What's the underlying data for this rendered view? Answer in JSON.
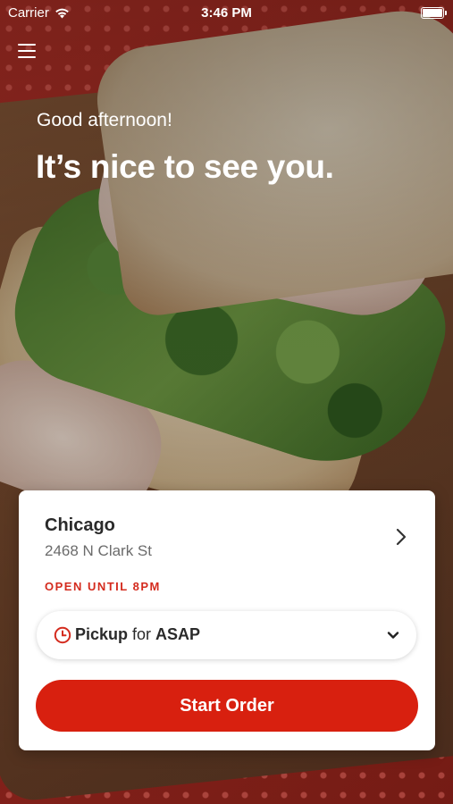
{
  "status_bar": {
    "carrier": "Carrier",
    "time": "3:46 PM"
  },
  "header": {
    "greeting": "Good afternoon!",
    "headline": "It’s nice to see you."
  },
  "location": {
    "city": "Chicago",
    "address": "2468 N Clark St",
    "hours": "OPEN UNTIL 8PM"
  },
  "order_mode": {
    "mode": "Pickup",
    "connector": "for",
    "time": "ASAP"
  },
  "cta": {
    "label": "Start Order"
  },
  "colors": {
    "brand_red": "#d8200f",
    "hours_red": "#d42b1e"
  },
  "icons": [
    "menu-icon",
    "wifi-icon",
    "battery-icon",
    "chevron-right-icon",
    "clock-icon",
    "chevron-down-icon"
  ]
}
